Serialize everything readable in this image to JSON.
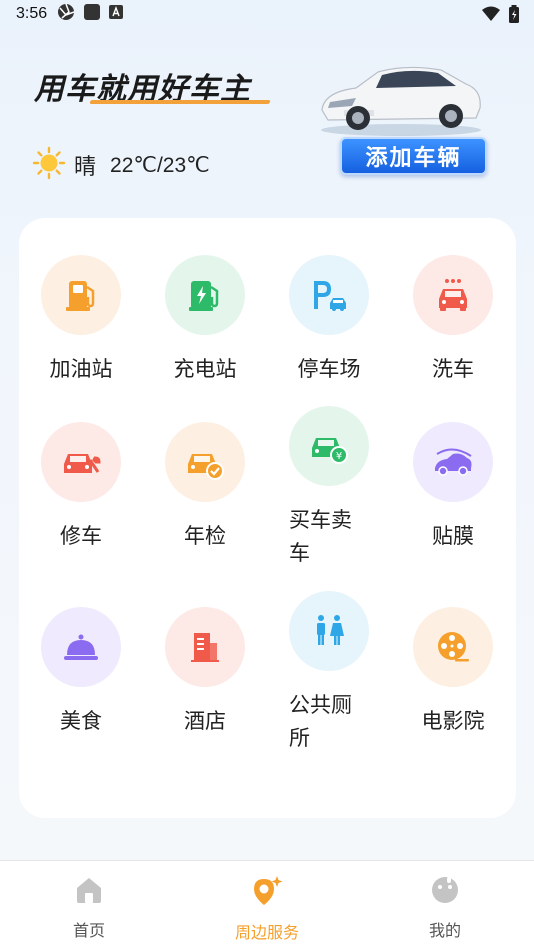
{
  "status_bar": {
    "time": "3:56"
  },
  "header": {
    "slogan": "用车就用好车主",
    "add_car_label": "添加车辆",
    "weather": {
      "condition": "晴",
      "temperature": "22℃/23℃",
      "icon": "sun-icon"
    }
  },
  "services": [
    {
      "label": "加油站",
      "icon": "gas-station-icon",
      "bg": "#fdf0e2",
      "color": "#f5a02c"
    },
    {
      "label": "充电站",
      "icon": "charging-station-icon",
      "bg": "#e4f6ec",
      "color": "#2dbb6a"
    },
    {
      "label": "停车场",
      "icon": "parking-icon",
      "bg": "#e6f4fb",
      "color": "#2fa7e6"
    },
    {
      "label": "洗车",
      "icon": "car-wash-icon",
      "bg": "#fde9e6",
      "color": "#f05a4a"
    },
    {
      "label": "修车",
      "icon": "car-repair-icon",
      "bg": "#fde9e6",
      "color": "#f05a4a"
    },
    {
      "label": "年检",
      "icon": "annual-inspection-icon",
      "bg": "#fdf0e2",
      "color": "#f5a02c"
    },
    {
      "label": "买车卖车",
      "icon": "car-trade-icon",
      "bg": "#e4f6ec",
      "color": "#2dbb6a"
    },
    {
      "label": "贴膜",
      "icon": "car-film-icon",
      "bg": "#efeafd",
      "color": "#8b6cf0"
    },
    {
      "label": "美食",
      "icon": "food-cloche-icon",
      "bg": "#efeafd",
      "color": "#8b6cf0"
    },
    {
      "label": "酒店",
      "icon": "hotel-icon",
      "bg": "#fde9e6",
      "color": "#f05a4a"
    },
    {
      "label": "公共厕所",
      "icon": "restroom-icon",
      "bg": "#e6f4fb",
      "color": "#2fa7e6"
    },
    {
      "label": "电影院",
      "icon": "cinema-reel-icon",
      "bg": "#fdf0e2",
      "color": "#f5a02c"
    }
  ],
  "bottom_nav": [
    {
      "label": "首页",
      "icon": "home-icon"
    },
    {
      "label": "周边服务",
      "icon": "nearby-service-icon",
      "active": true
    },
    {
      "label": "我的",
      "icon": "profile-icon"
    }
  ],
  "colors": {
    "accent": "#f5a02c",
    "button_blue": "#1f6fee"
  }
}
